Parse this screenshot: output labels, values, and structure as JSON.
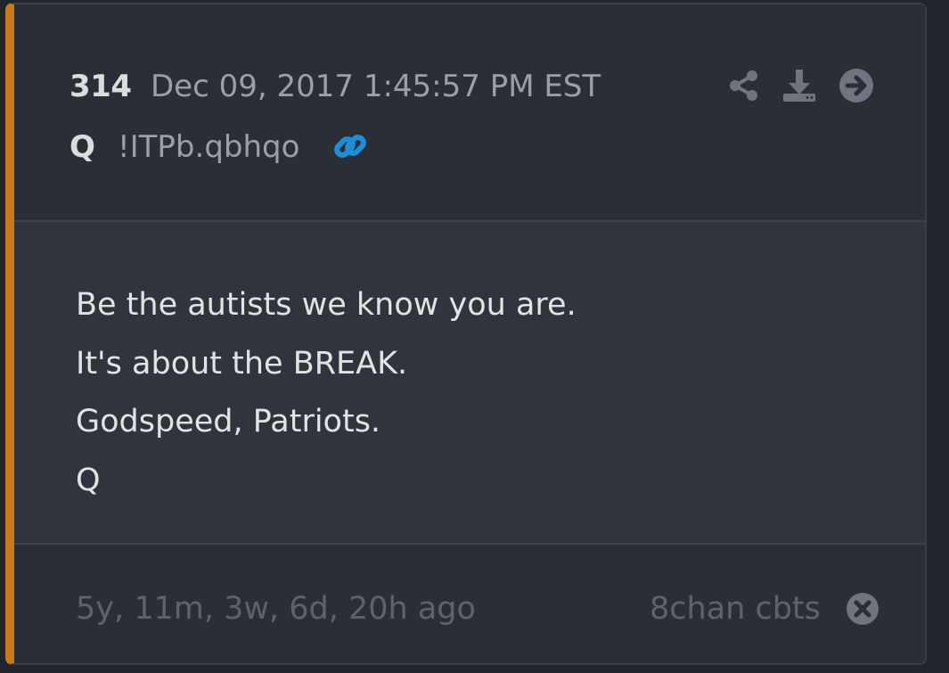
{
  "post": {
    "number": "314",
    "date": "Dec 09, 2017 1:45:57 PM EST",
    "author": "Q",
    "tripcode": "!ITPb.qbhqo",
    "lines": [
      "Be the autists we know you are.",
      "It's about the BREAK.",
      "Godspeed, Patriots.",
      "Q"
    ],
    "age": "5y, 11m, 3w, 6d, 20h ago",
    "source": "8chan cbts"
  },
  "icons": {
    "header": [
      "share-icon",
      "download-icon",
      "arrow-right-circle-icon"
    ],
    "link": "link-icon",
    "footer": "close-circle-icon"
  },
  "colors": {
    "accent_stripe": "#c77a1f",
    "link_icon": "#1e8fd6",
    "card_bg": "#2a2f37",
    "body_bg": "#2f343d"
  }
}
